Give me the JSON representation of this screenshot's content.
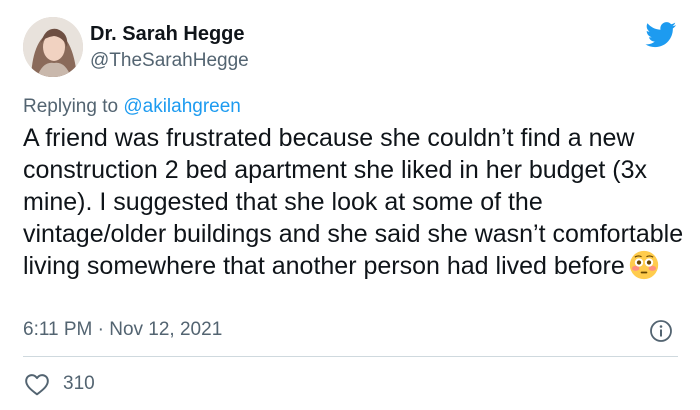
{
  "author": {
    "display_name": "Dr. Sarah Hegge",
    "handle": "@TheSarahHegge",
    "avatar_icon": "profile-photo"
  },
  "reply": {
    "prefix": "Replying to ",
    "mention": "@akilahgreen"
  },
  "tweet": {
    "text": "A friend was frustrated because she couldn’t find a new construction 2 bed apartment she liked in her budget (3x mine). I suggested that she look at some of the vintage/older buildings and she said she wasn’t comfortable living somewhere that another person had lived before",
    "emoji": "flushed-face-emoji",
    "timestamp": "6:11 PM · Nov 12, 2021"
  },
  "stats": {
    "likes": "310"
  },
  "colors": {
    "brand": "#1d9bf0",
    "text": "#0f1419",
    "muted": "#536471",
    "divider": "#cfd9de"
  },
  "icons": {
    "logo": "twitter-bird-icon",
    "info": "info-icon",
    "like": "heart-icon"
  }
}
